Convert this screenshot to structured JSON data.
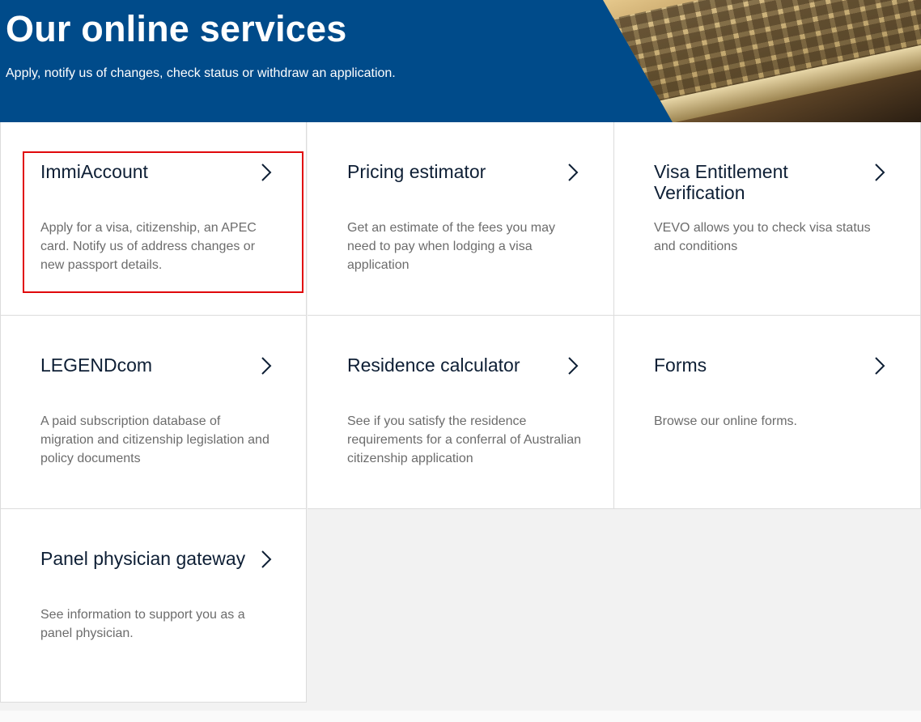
{
  "hero": {
    "title": "Our online services",
    "subtitle": "Apply, notify us of changes, check status or withdraw an application."
  },
  "cards": [
    {
      "title": "ImmiAccount",
      "description": "Apply for a visa, citizenship, an APEC card. Notify us of address changes or new passport details.",
      "icon": "chevron-right-icon",
      "highlighted": true
    },
    {
      "title": "Pricing estimator",
      "description": "Get an estimate of the fees you may need to pay when lodging a visa application",
      "icon": "chevron-right-icon"
    },
    {
      "title": "Visa Entitlement Verification",
      "description": "VEVO allows you to check visa status and conditions",
      "icon": "chevron-right-icon"
    },
    {
      "title": "LEGENDcom",
      "description": "A paid subscription database of migration and citizenship legislation and policy documents",
      "icon": "chevron-right-icon"
    },
    {
      "title": "Residence calculator",
      "description": "See if you satisfy the residence requirements for a conferral of Australian citizenship application",
      "icon": "chevron-right-icon"
    },
    {
      "title": "Forms",
      "description": "Browse our online forms.",
      "icon": "chevron-right-icon"
    },
    {
      "title": "Panel physician gateway",
      "description": "See information to support you as a panel physician.",
      "icon": "chevron-right-icon"
    }
  ],
  "colors": {
    "hero_background": "#004b8a",
    "highlight_border": "#e0080b",
    "title_text": "#0e1f35",
    "description_text": "#6c6c6c"
  }
}
